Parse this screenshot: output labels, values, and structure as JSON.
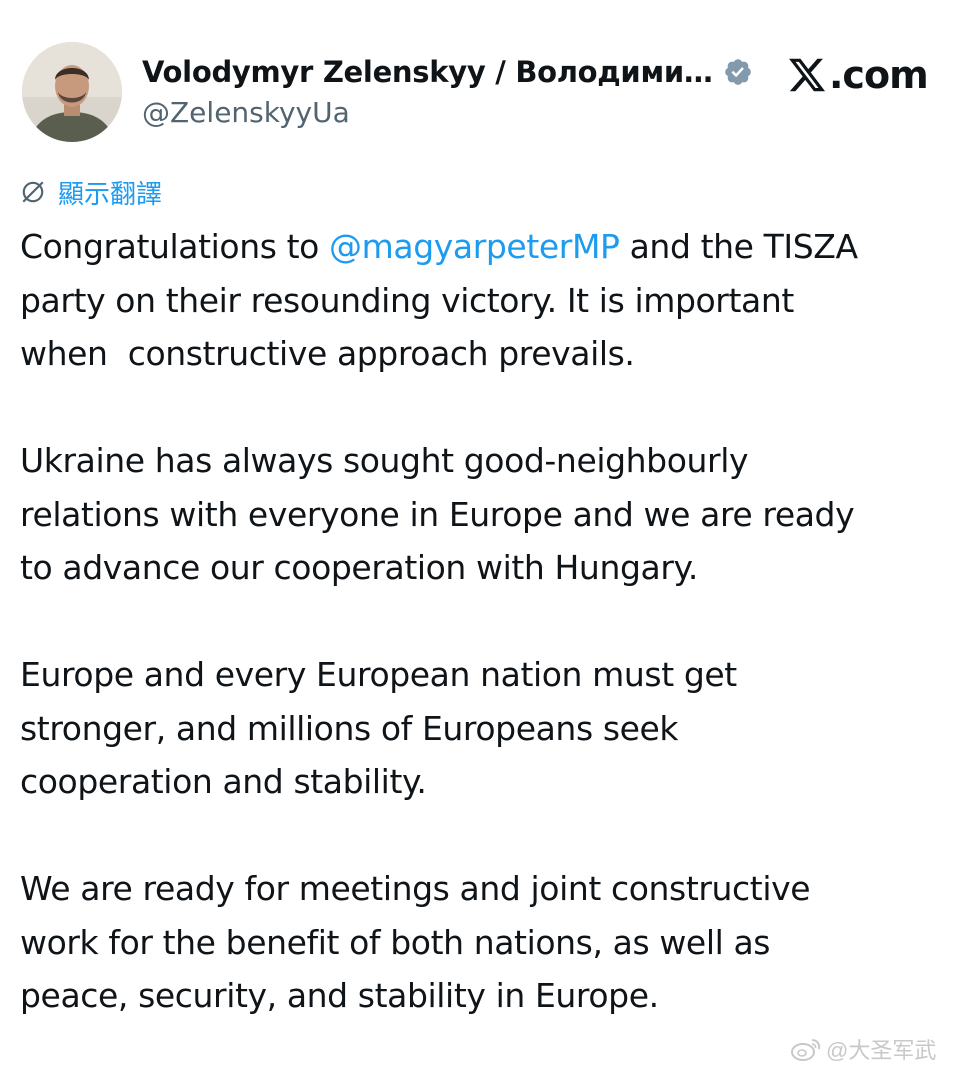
{
  "header": {
    "display_name": "Volodymyr Zelenskyy / Володими…",
    "handle": "@ZelenskyyUa",
    "site": ".com",
    "avatar_icon": "profile-photo",
    "verified_icon": "verified-badge-icon",
    "logo_icon": "x-logo-icon"
  },
  "translate": {
    "label": "顯示翻譯",
    "icon": "translate-icon"
  },
  "tweet": {
    "p1": {
      "pre": "Congratulations to ",
      "mention": "@magyarpeterMP",
      "post": " and the TISZA\nparty on their resounding victory. It is important\nwhen  constructive approach prevails."
    },
    "p2": "Ukraine has always sought good-neighbourly\nrelations with everyone in Europe and we are ready\nto advance our cooperation with Hungary.",
    "p3": "Europe and every European nation must get\nstronger, and millions of Europeans seek\ncooperation and stability.",
    "p4": "We are ready for meetings and joint constructive\nwork for the benefit of both nations, as well as\npeace, security, and stability in Europe."
  },
  "watermark": {
    "text": "@大圣军武",
    "icon": "weibo-logo-icon"
  },
  "colors": {
    "link": "#1d9bf0",
    "text": "#0f1419",
    "secondary": "#536471",
    "badge": "#829aab"
  }
}
